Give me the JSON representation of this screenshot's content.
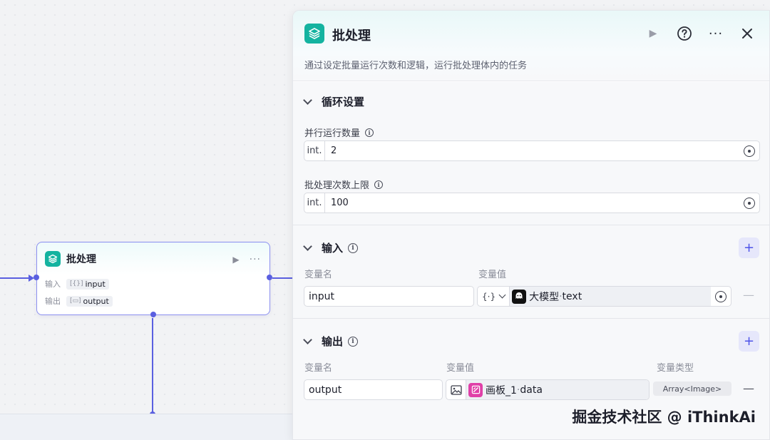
{
  "node": {
    "title": "批处理",
    "input_label": "输入",
    "input_var": "input",
    "output_label": "输出",
    "output_var": "output"
  },
  "panel": {
    "title": "批处理",
    "description": "通过设定批量运行次数和逻辑，运行批处理体内的任务",
    "loop_section": {
      "title": "循环设置",
      "parallel_label": "并行运行数量",
      "parallel_type": "int.",
      "parallel_value": "2",
      "max_label": "批处理次数上限",
      "max_type": "int.",
      "max_value": "100"
    },
    "input_section": {
      "title": "输入",
      "col_name": "变量名",
      "col_value": "变量值",
      "row_name": "input",
      "row_type_icon": "{·}",
      "row_source": "大模型",
      "row_sep": " · ",
      "row_field": "text"
    },
    "output_section": {
      "title": "输出",
      "col_name": "变量名",
      "col_value": "变量值",
      "col_type": "变量类型",
      "row_name": "output",
      "row_source": "画板_1",
      "row_sep": " · ",
      "row_field": "data",
      "row_type": "Array<Image>"
    }
  },
  "icons": {
    "node_logo": "layers-icon",
    "play": "play-icon",
    "help": "help-circle-icon",
    "more": "more-icon",
    "close": "close-icon",
    "add": "plus-icon",
    "remove": "minus-icon"
  },
  "watermark": "掘金技术社区 @ iThinkAi",
  "colors": {
    "accent": "#4d53e8",
    "connector": "#5a5fe0",
    "brand_teal": "#14b3a0",
    "canvas_source_pink": "#e040a8"
  }
}
